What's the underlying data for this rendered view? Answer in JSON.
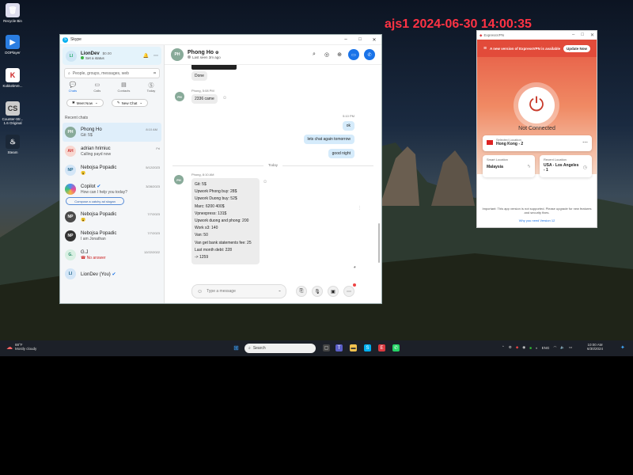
{
  "watermark": "ajs1 2024-06-30 14:00:35",
  "desktop_icons": [
    "Recycle Bin",
    "DOPlayer",
    "KokkeleVe...",
    "Counter-Str... 1.6 Original",
    "Steam"
  ],
  "skype": {
    "title": "Skype",
    "profile": {
      "name": "LionDev",
      "balance": "$0.00",
      "status": "Set a status",
      "initials": "LI"
    },
    "search_placeholder": "People, groups, messages, web",
    "nav": [
      "Chats",
      "Calls",
      "Contacts",
      "Today"
    ],
    "meet_now": "Meet Now",
    "new_chat": "New Chat",
    "recent_chats_label": "Recent chats",
    "chats": [
      {
        "name": "Phong Ho",
        "preview": "Git: 5$",
        "date": "8:10 AM",
        "initials": "PH"
      },
      {
        "name": "adrian hrimiuc",
        "preview": "Calling payd now",
        "date": "Fri",
        "initials": "AH"
      },
      {
        "name": "Nebojsa Popadic",
        "preview": "😮",
        "date": "5/12/2023",
        "initials": "NP"
      },
      {
        "name": "Copilot",
        "preview": "How can I help you today?",
        "date": "3/28/2023",
        "initials": "C"
      },
      {
        "name": "Nebojsa Popadic",
        "preview": "😮",
        "date": "7/7/2023",
        "initials": "NP"
      },
      {
        "name": "Nebojsa Popadic",
        "preview": "I am Jonathan",
        "date": "7/7/2023",
        "initials": "NP"
      },
      {
        "name": "G.J",
        "preview": "No answer",
        "date": "12/22/2022",
        "initials": "G."
      },
      {
        "name": "LionDev (You)",
        "preview": "",
        "date": "",
        "initials": "LI"
      }
    ],
    "copilot_suggestion": "Compose a catchy ad slogan",
    "conversation": {
      "name": "Phong Ho",
      "last_seen": "Last seen 3m ago",
      "done_text": "Done",
      "msg1_meta": "Phong, 5:08 PM",
      "msg1": "2336 came",
      "out_time": "5:10 PM",
      "out_msgs": [
        "ok",
        "lets chat again tomorrow",
        "good night"
      ],
      "day_divider": "Today",
      "msg2_meta": "Phong, 8:10 AM",
      "msg2_lines": [
        "Git: 5$",
        "Upwork Phong buy: 28$",
        "Upwork Duong buy: 52$",
        "Marc: 6200 400$",
        "Vpnexpress: 131$",
        "Upwork duong and phong: 200",
        "Work s3: 140",
        "Van: 50",
        "Van get bank statements fee: 25",
        "Last month debt: 228",
        "-> 1259"
      ],
      "compose_placeholder": "Type a message"
    }
  },
  "vpn": {
    "title": "ExpressVPN",
    "banner": "A new version of ExpressVPN is available",
    "update_button": "Update Now",
    "status": "Not Connected",
    "selected_label": "Selected Location",
    "selected_value": "Hong Kong - 2",
    "smart_label": "Smart Location",
    "smart_value": "Malaysia",
    "recent_label": "Recent Location",
    "recent_value": "USA - Los Angeles - 1",
    "notice": "Important: This app version is not supported. Please upgrade for new features and security fixes.",
    "why_link": "Why you need Version 12"
  },
  "taskbar": {
    "weather_temp": "88°F",
    "weather_desc": "Mostly cloudy",
    "search": "Search",
    "lang": "ENG",
    "time": "10:00 AM",
    "date": "6/30/2024"
  },
  "colors": {
    "skype_blue": "#1a73e8",
    "vpn_red": "#e24b3a",
    "watermark": "#ff3344"
  }
}
